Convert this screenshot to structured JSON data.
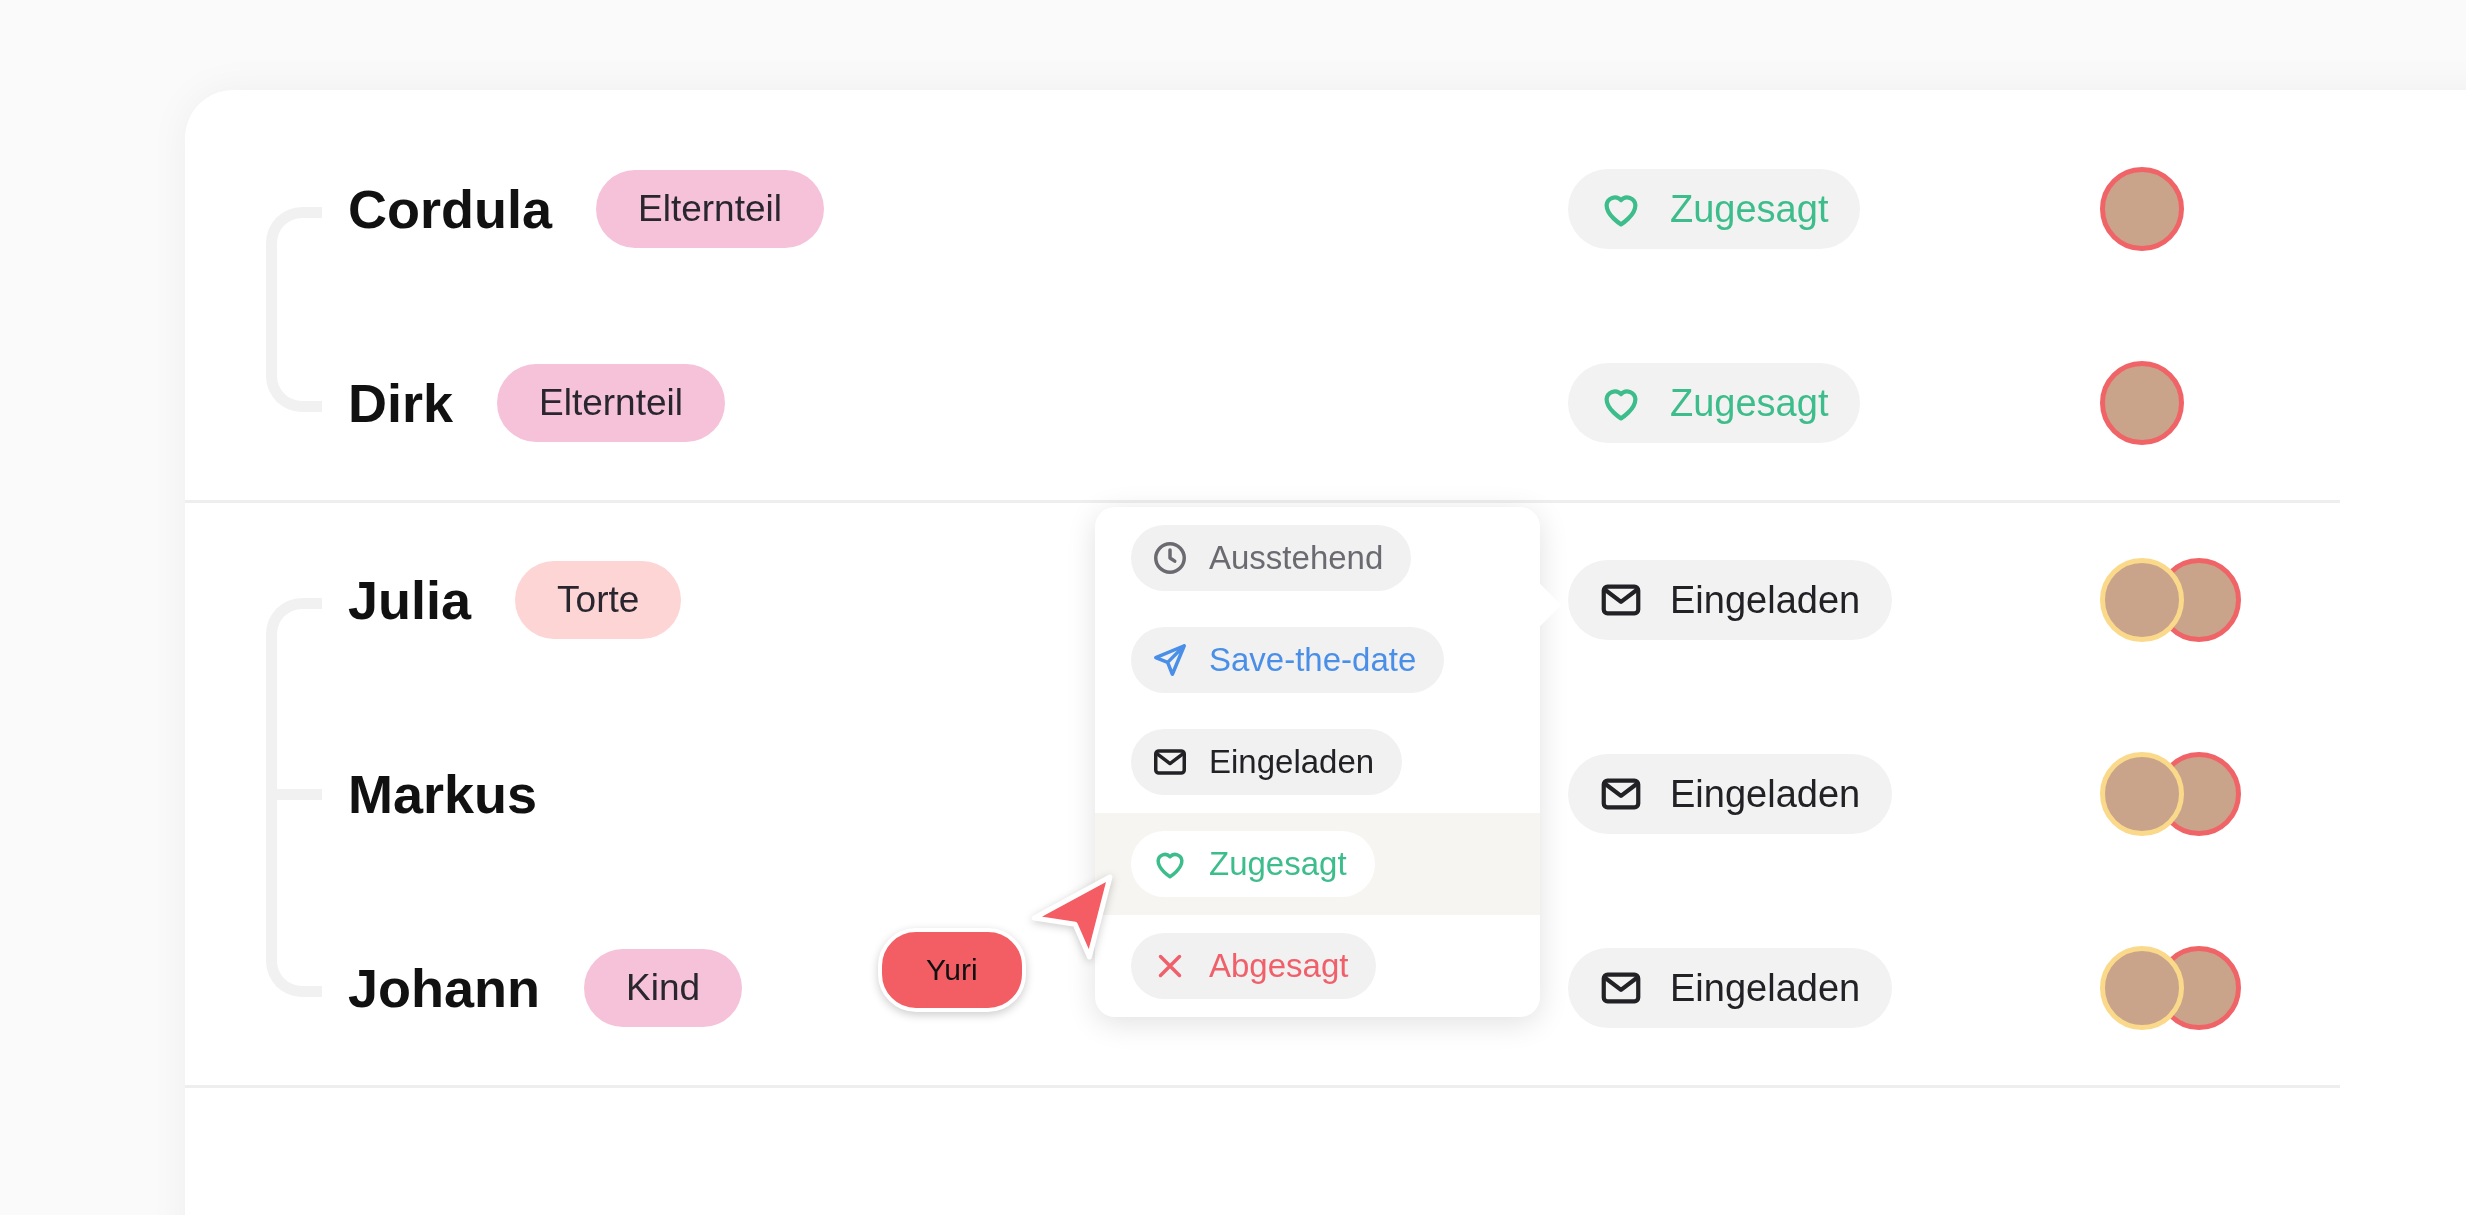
{
  "groups": [
    {
      "members": [
        {
          "name": "Cordula",
          "tag": {
            "label": "Elternteil",
            "color": "#f5c2d9"
          },
          "status": {
            "kind": "accepted",
            "label": "Zugesagt"
          },
          "avatars": [
            {
              "color": "#f06468"
            }
          ]
        },
        {
          "name": "Dirk",
          "tag": {
            "label": "Elternteil",
            "color": "#f5c2d9"
          },
          "status": {
            "kind": "accepted",
            "label": "Zugesagt"
          },
          "avatars": [
            {
              "color": "#f06468"
            }
          ]
        }
      ]
    },
    {
      "members": [
        {
          "name": "Julia",
          "tag": {
            "label": "Torte",
            "color": "#fdd5d5"
          },
          "status": {
            "kind": "invited",
            "label": "Eingeladen"
          },
          "avatars": [
            {
              "color": "#fbd98a"
            },
            {
              "color": "#f06468"
            }
          ]
        },
        {
          "name": "Markus",
          "status": {
            "kind": "invited",
            "label": "Eingeladen"
          },
          "avatars": [
            {
              "color": "#fbd98a"
            },
            {
              "color": "#f06468"
            }
          ]
        },
        {
          "name": "Johann",
          "tag": {
            "label": "Kind",
            "color": "#f5c2d9"
          },
          "status": {
            "kind": "invited",
            "label": "Eingeladen"
          },
          "avatars": [
            {
              "color": "#fbd98a"
            },
            {
              "color": "#f06468"
            }
          ]
        }
      ]
    }
  ],
  "status_menu": {
    "options": [
      {
        "kind": "pending",
        "label": "Ausstehend",
        "selected": false
      },
      {
        "kind": "save",
        "label": "Save-the-date",
        "selected": false
      },
      {
        "kind": "invited",
        "label": "Eingeladen",
        "selected": false
      },
      {
        "kind": "accepted",
        "label": "Zugesagt",
        "selected": true
      },
      {
        "kind": "declined",
        "label": "Abgesagt",
        "selected": false
      }
    ]
  },
  "cursor": {
    "label": "Yuri"
  }
}
